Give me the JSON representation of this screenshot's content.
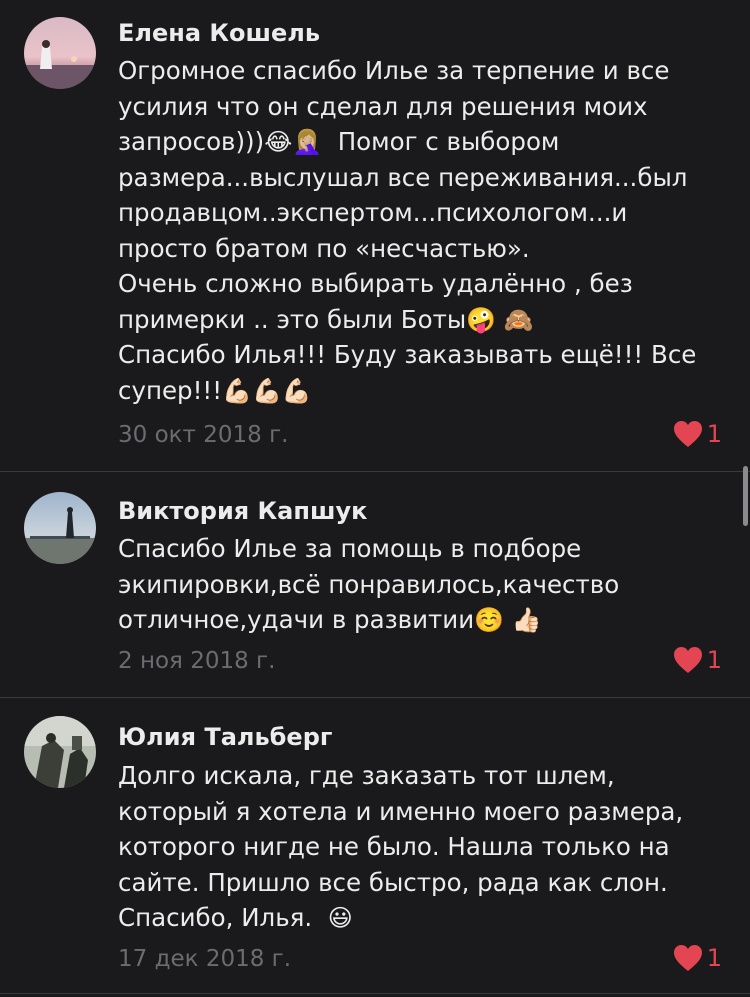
{
  "comments": [
    {
      "author": "Елена Кошель",
      "lines": [
        "Огромное спасибо Илье за терпение и все",
        "усилия что он сделал для решения моих",
        "запросов)))",
        "Помог с выбором",
        "размера...выслушал все переживания...был",
        "продавцом..экспертом...психологом...и",
        "просто братом по «несчастью».",
        "Очень сложно выбирать удалённо , без",
        "примерки .. это были Боты",
        "Спасибо Илья!!! Буду заказывать ещё!!! Все",
        "супер!!!"
      ],
      "emojis": {
        "laugh": "😂",
        "facepalm": "🤦🏼‍♀️",
        "zany": "🤪",
        "see_no_evil": "🙈",
        "muscle": "💪🏻💪🏻💪🏻"
      },
      "date": "30 окт 2018 г.",
      "likes": "1"
    },
    {
      "author": "Виктория Капшук",
      "lines": [
        "Спасибо Илье за помощь в подборе",
        "экипировки,всё понравилось,качество",
        "отличное,удачи в развитии"
      ],
      "emojis": {
        "relaxed": "☺️",
        "thumbs_up": "👍🏻"
      },
      "date": "2 ноя 2018 г.",
      "likes": "1"
    },
    {
      "author": "Юлия Тальберг",
      "lines": [
        "Долго искала, где заказать тот шлем,",
        "который я хотела и именно моего размера,",
        "которого нигде не было. Нашла только на",
        "сайте. Пришло все быстро, рада как слон.",
        "Спасибо, Илья. "
      ],
      "emojis": {
        "smile": "😃"
      },
      "date": "17 дек 2018 г.",
      "likes": "1"
    }
  ],
  "colors": {
    "background": "#1a191b",
    "text": "#ececec",
    "date": "#6c6b70",
    "like": "#e34553",
    "divider": "#3a393d"
  }
}
